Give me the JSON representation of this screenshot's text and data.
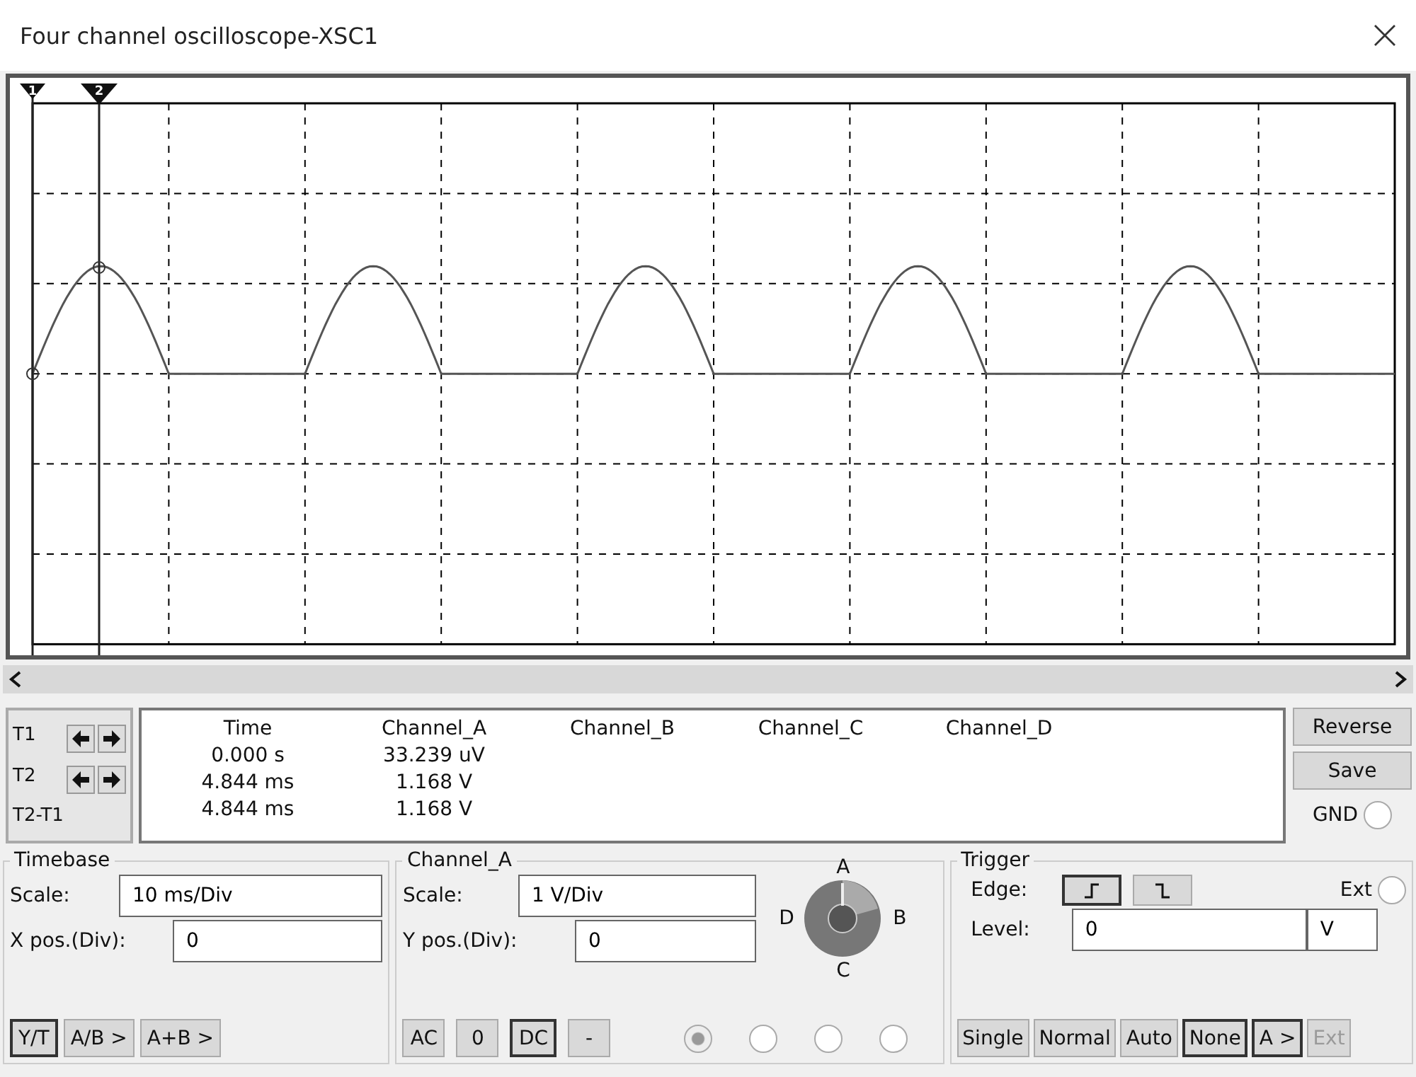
{
  "window": {
    "title": "Four channel oscilloscope-XSC1"
  },
  "display": {
    "cursors": [
      {
        "label": "1"
      },
      {
        "label": "2"
      }
    ]
  },
  "readout": {
    "cursor_rows": [
      {
        "label": "T1",
        "arrows": true
      },
      {
        "label": "T2",
        "arrows": true
      },
      {
        "label": "T2-T1",
        "arrows": false
      }
    ],
    "columns": [
      "Time",
      "Channel_A",
      "Channel_B",
      "Channel_C",
      "Channel_D"
    ],
    "rows": [
      [
        "0.000 s",
        "33.239 uV"
      ],
      [
        "4.844 ms",
        "1.168 V"
      ],
      [
        "4.844 ms",
        "1.168 V"
      ]
    ]
  },
  "side_buttons": [
    "Reverse",
    "Save"
  ],
  "gnd": {
    "label": "GND",
    "selected": false
  },
  "timebase": {
    "title": "Timebase",
    "scale_label": "Scale:",
    "scale": "10 ms/Div",
    "xpos_label": "X pos.(Div):",
    "xpos": "0",
    "modes": [
      {
        "label": "Y/T",
        "selected": true
      },
      {
        "label": "A/B >",
        "selected": false
      },
      {
        "label": "A+B >",
        "selected": false
      }
    ]
  },
  "channel": {
    "title": "Channel_A",
    "scale_label": "Scale:",
    "scale": "1 V/Div",
    "ypos_label": "Y pos.(Div):",
    "ypos": "0",
    "coupling": [
      {
        "label": "AC",
        "selected": false
      },
      {
        "label": "0",
        "selected": false
      },
      {
        "label": "DC",
        "selected": true
      },
      {
        "label": "-",
        "selected": false
      }
    ],
    "selector_labels": [
      "A",
      "B",
      "C",
      "D"
    ],
    "channel_radios": [
      {
        "selected": true
      },
      {
        "selected": false
      },
      {
        "selected": false
      },
      {
        "selected": false
      }
    ]
  },
  "trigger": {
    "title": "Trigger",
    "edge_label": "Edge:",
    "edges": [
      {
        "kind": "rising",
        "selected": true
      },
      {
        "kind": "falling",
        "selected": false
      }
    ],
    "ext": {
      "label": "Ext",
      "selected": false
    },
    "level_label": "Level:",
    "level_value": "0",
    "level_unit": "V",
    "modes": [
      {
        "label": "Single",
        "selected": false,
        "disabled": false
      },
      {
        "label": "Normal",
        "selected": false,
        "disabled": false
      },
      {
        "label": "Auto",
        "selected": false,
        "disabled": false
      },
      {
        "label": "None",
        "selected": true,
        "disabled": false
      },
      {
        "label": "A >",
        "selected": true,
        "disabled": false
      },
      {
        "label": "Ext",
        "selected": false,
        "disabled": true
      }
    ]
  }
}
